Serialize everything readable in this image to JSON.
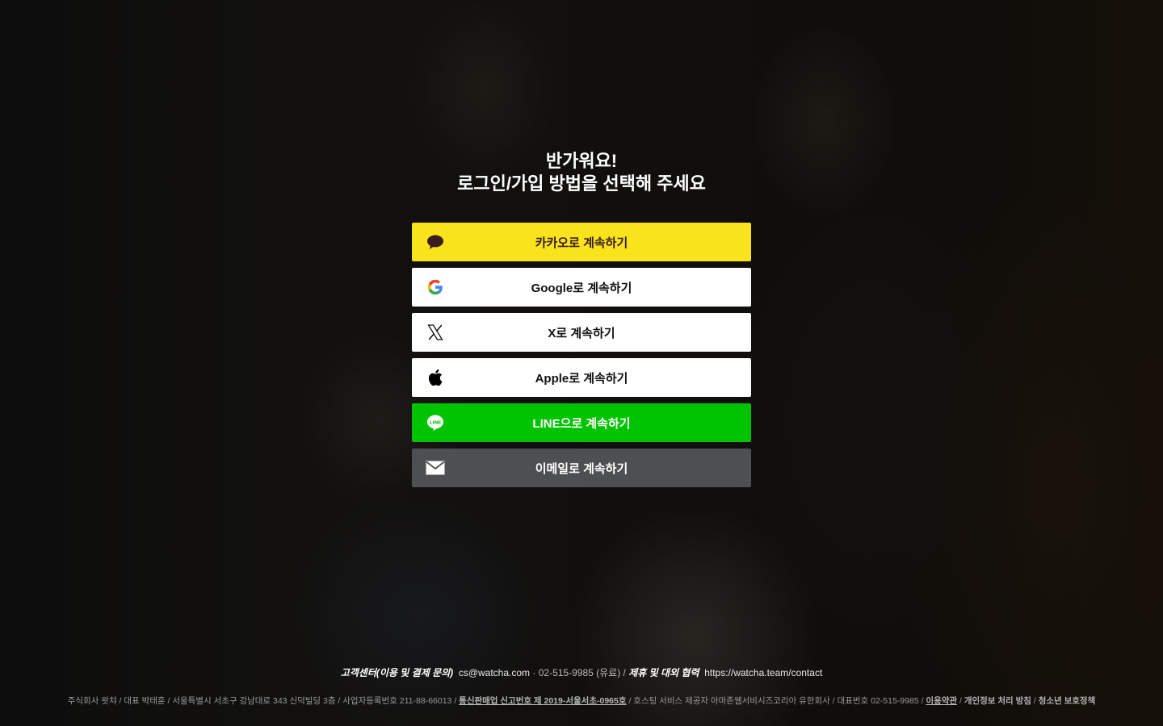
{
  "greeting": {
    "line1": "반가워요!",
    "line2": "로그인/가입 방법을 선택해 주세요"
  },
  "buttons": {
    "kakao": {
      "label": "카카오로 계속하기",
      "icon": "kakao-chat-bubble-icon",
      "color": "#f9e31c"
    },
    "google": {
      "label": "Google로 계속하기",
      "icon": "google-g-icon",
      "color": "#ffffff"
    },
    "x": {
      "label": "X로 계속하기",
      "icon": "x-logo-icon",
      "color": "#ffffff"
    },
    "apple": {
      "label": "Apple로 계속하기",
      "icon": "apple-logo-icon",
      "color": "#ffffff"
    },
    "line": {
      "label": "LINE으로 계속하기",
      "icon": "line-logo-icon",
      "color": "#00c300"
    },
    "email": {
      "label": "이메일로 계속하기",
      "icon": "envelope-icon",
      "color": "#4e4f52"
    }
  },
  "footer": {
    "support_label": "고객센터(이용 및 결제 문의)",
    "support_email": "cs@watcha.com",
    "separator_dot": "·",
    "phone": "02-515-9985 (유료)",
    "slash": "/",
    "partnership_label": "제휴 및 대외 협력",
    "partnership_url": "https://watcha.team/contact",
    "legal_prefix": "주식회사 왓챠 / 대표 박태훈 / 서울특별시 서초구 강남대로 343 신덕빌딩 3층 / 사업자등록번호 211-88-66013 /",
    "ecommerce_registration": "통신판매업 신고번호 제 2019-서울서초-0965호",
    "legal_middle": "/ 호스팅 서비스 제공자 아마존웹서비시즈코리아 유한회사 / 대표번호 02-515-9985 /",
    "terms": "이용약관",
    "privacy": "개인정보 처리 방침",
    "youth": "청소년 보호정책"
  }
}
